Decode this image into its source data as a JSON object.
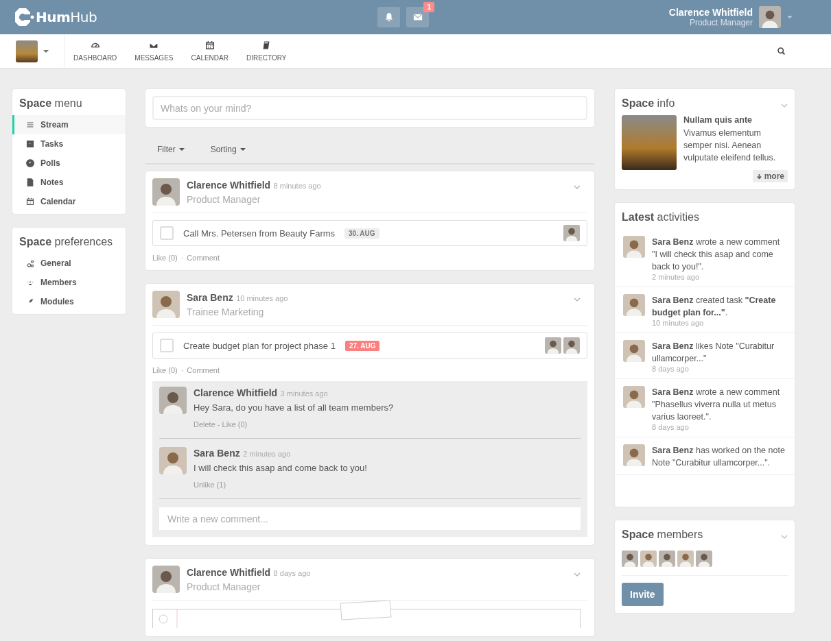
{
  "topbar": {
    "logo": "**Hum**Hub",
    "message_count": "1",
    "user": {
      "name": "Clarence Whitfield",
      "title": "Product Manager"
    }
  },
  "nav": [
    {
      "label": "DASHBOARD"
    },
    {
      "label": "MESSAGES"
    },
    {
      "label": "CALENDAR"
    },
    {
      "label": "DIRECTORY"
    }
  ],
  "space_menu": {
    "title": "**Space** menu",
    "items": [
      {
        "label": "Stream",
        "selected": true
      },
      {
        "label": "Tasks",
        "selected": false
      },
      {
        "label": "Polls",
        "selected": false
      },
      {
        "label": "Notes",
        "selected": false
      },
      {
        "label": "Calendar",
        "selected": false
      }
    ]
  },
  "space_preferences": {
    "title": "**Space** preferences",
    "items": [
      {
        "label": "General"
      },
      {
        "label": "Members"
      },
      {
        "label": "Modules"
      }
    ]
  },
  "composer": {
    "placeholder": "Whats on your mind?"
  },
  "stream_filters": [
    "Filter",
    "Sorting"
  ],
  "posts": [
    {
      "author": "Clarence Whitfield",
      "time": "8 minutes ago",
      "role": "Product Manager",
      "kind": "task",
      "task": {
        "text": "Call Mrs. Petersen from Beauty Farms",
        "due": "30. AUG",
        "overdue": false,
        "checked": false
      },
      "actions": [
        "Like (0)",
        "Comment"
      ],
      "separator": "·"
    },
    {
      "author": "Sara Benz",
      "time": "10 minutes ago",
      "role": "Trainee Marketing",
      "kind": "task",
      "task": {
        "text": "Create budget plan for project phase 1",
        "due": "27. AUG",
        "overdue": true,
        "checked": false
      },
      "actions": [
        "Like (0)",
        "Comment"
      ],
      "separator": "·",
      "comments": [
        {
          "author": "Clarence Whitfield",
          "time": "3 minutes ago",
          "text": "Hey Sara, do you have a list of all team members?",
          "actions": "Delete - Like (0)"
        },
        {
          "author": "Sara Benz",
          "time": "2 minutes ago",
          "text": "I will check this asap and come back to you!",
          "actions": "Unlike (1)"
        }
      ],
      "comment_placeholder": "Write a new comment..."
    },
    {
      "author": "Clarence Whitfield",
      "time": "8 days ago",
      "role": "Product Manager",
      "kind": "note"
    }
  ],
  "space_info": {
    "title": "**Space** info",
    "heading": "Nullam quis ante",
    "text": "Vivamus elementum semper nisi. Aenean vulputate eleifend tellus.",
    "more": "more"
  },
  "activities": {
    "title": "**Latest** activities",
    "items": [
      {
        "text": "**Sara Benz** wrote a new comment \"I will check this asap and come back to you!\".",
        "time": "2 minutes ago"
      },
      {
        "text": "**Sara Benz** created task **\"Create budget plan for...\"**.",
        "time": "10 minutes ago"
      },
      {
        "text": "**Sara Benz** likes Note \"Curabitur ullamcorper...\"",
        "time": "8 days ago"
      },
      {
        "text": "**Sara Benz** wrote a new comment \"Phasellus viverra nulla ut metus varius laoreet.\".",
        "time": "8 days ago"
      },
      {
        "text": "**Sara Benz** has worked on the note Note \"Curabitur ullamcorper...\"."
      }
    ]
  },
  "space_members": {
    "title": "**Space** members",
    "invite": "Invite"
  }
}
